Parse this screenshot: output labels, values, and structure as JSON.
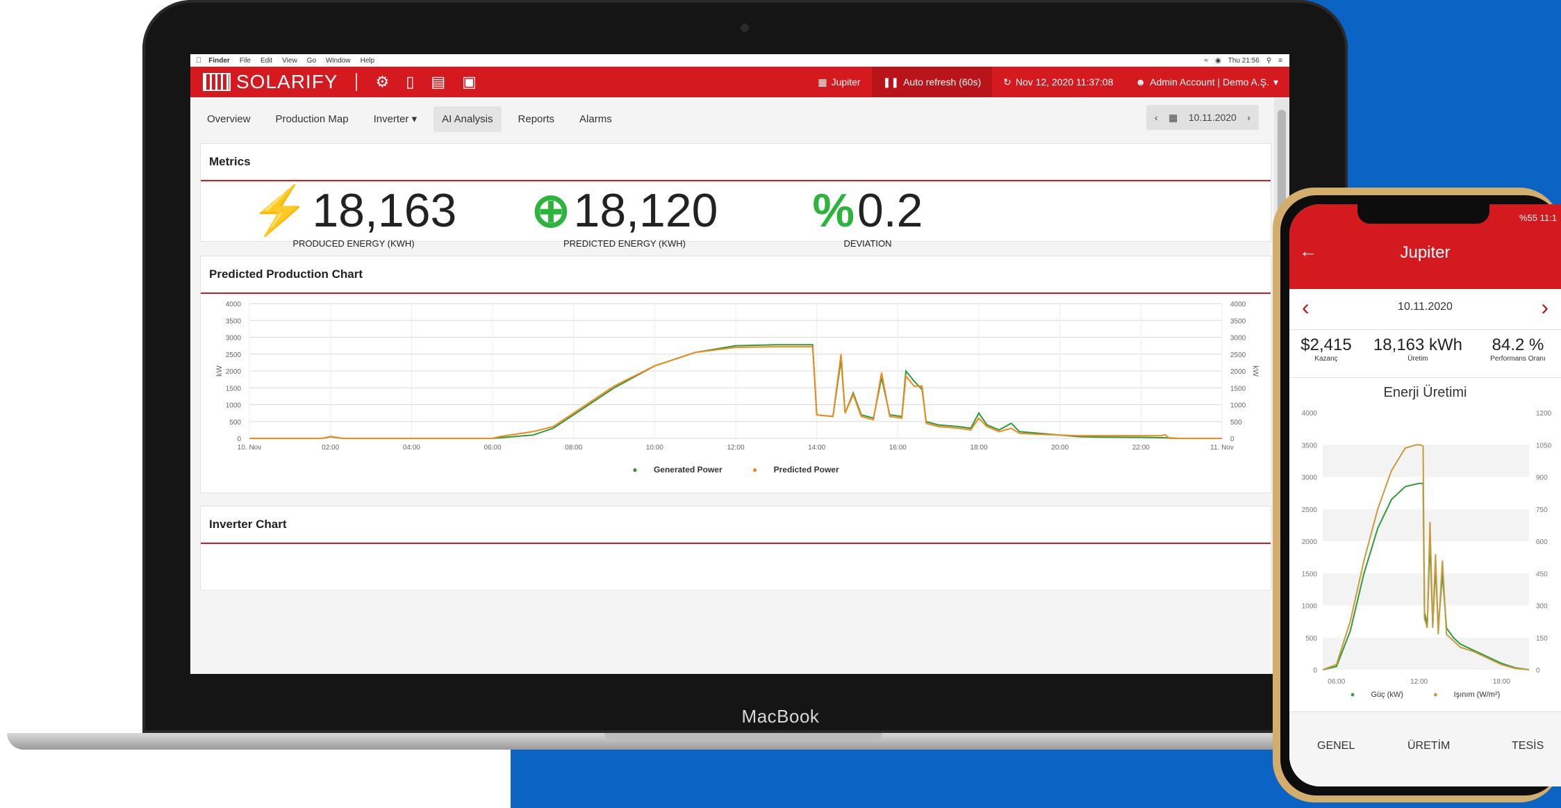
{
  "menubar": {
    "apple": "",
    "items": [
      "Finder",
      "File",
      "Edit",
      "View",
      "Go",
      "Window",
      "Help"
    ],
    "clock": "Thu 21:56"
  },
  "app": {
    "brand": "SOLARIFY",
    "header": {
      "plant": "Jupiter",
      "auto_refresh": "Auto refresh (60s)",
      "datetime": "Nov 12, 2020 11:37:08",
      "account": "Admin Account | Demo A.Ş."
    },
    "nav": {
      "tabs": [
        "Overview",
        "Production Map",
        "Inverter",
        "AI Analysis",
        "Reports",
        "Alarms"
      ],
      "date": "10.11.2020"
    },
    "metrics": {
      "title": "Metrics",
      "items": [
        {
          "value": "18,163",
          "label": "PRODUCED ENERGY (KWH)",
          "icon": "plug-icon"
        },
        {
          "value": "18,120",
          "label": "PREDICTED ENERGY (KWH)",
          "icon": "target-icon"
        },
        {
          "value": "0.2",
          "label": "DEVIATION",
          "icon": "percent-icon"
        }
      ]
    },
    "chart_section_title": "Predicted Production Chart",
    "next_section_title": "Inverter Chart"
  },
  "chart_data": [
    {
      "type": "line",
      "ylabel": "kW",
      "ylim": [
        0,
        4000
      ],
      "yticks": [
        0,
        500,
        1000,
        1500,
        2000,
        2500,
        3000,
        3500,
        4000
      ],
      "xticks": [
        "10. Nov",
        "02:00",
        "04:00",
        "06:00",
        "08:00",
        "10:00",
        "12:00",
        "14:00",
        "16:00",
        "18:00",
        "20:00",
        "22:00",
        "11. Nov"
      ],
      "xrange_hours": [
        0,
        24
      ],
      "series": [
        {
          "name": "Generated Power",
          "color": "#2e9a3a",
          "points": [
            [
              0,
              0
            ],
            [
              1.8,
              0
            ],
            [
              2,
              50
            ],
            [
              2.3,
              0
            ],
            [
              6,
              0
            ],
            [
              7,
              100
            ],
            [
              7.5,
              300
            ],
            [
              8,
              700
            ],
            [
              9,
              1500
            ],
            [
              10,
              2150
            ],
            [
              11,
              2550
            ],
            [
              12,
              2750
            ],
            [
              13,
              2780
            ],
            [
              13.9,
              2780
            ],
            [
              14,
              700
            ],
            [
              14.4,
              650
            ],
            [
              14.6,
              2350
            ],
            [
              14.7,
              750
            ],
            [
              14.9,
              1350
            ],
            [
              15.1,
              700
            ],
            [
              15.4,
              600
            ],
            [
              15.6,
              1800
            ],
            [
              15.8,
              700
            ],
            [
              16.1,
              650
            ],
            [
              16.2,
              2000
            ],
            [
              16.4,
              1700
            ],
            [
              16.6,
              1450
            ],
            [
              16.7,
              500
            ],
            [
              17,
              400
            ],
            [
              17.5,
              350
            ],
            [
              17.8,
              300
            ],
            [
              18,
              750
            ],
            [
              18.2,
              400
            ],
            [
              18.5,
              250
            ],
            [
              18.8,
              450
            ],
            [
              19,
              200
            ],
            [
              19.5,
              150
            ],
            [
              20,
              100
            ],
            [
              20.5,
              50
            ],
            [
              21,
              40
            ],
            [
              22,
              30
            ],
            [
              22.5,
              20
            ],
            [
              23,
              0
            ],
            [
              24,
              0
            ]
          ]
        },
        {
          "name": "Predicted Power",
          "color": "#f08a1c",
          "points": [
            [
              0,
              0
            ],
            [
              1.8,
              0
            ],
            [
              2,
              60
            ],
            [
              2.3,
              0
            ],
            [
              6,
              0
            ],
            [
              6.2,
              60
            ],
            [
              7,
              200
            ],
            [
              7.5,
              350
            ],
            [
              8,
              750
            ],
            [
              9,
              1550
            ],
            [
              10,
              2150
            ],
            [
              11,
              2550
            ],
            [
              12,
              2700
            ],
            [
              13,
              2720
            ],
            [
              13.9,
              2720
            ],
            [
              14,
              700
            ],
            [
              14.4,
              650
            ],
            [
              14.6,
              2500
            ],
            [
              14.7,
              750
            ],
            [
              14.9,
              1300
            ],
            [
              15.1,
              650
            ],
            [
              15.4,
              550
            ],
            [
              15.6,
              1950
            ],
            [
              15.8,
              650
            ],
            [
              16.1,
              600
            ],
            [
              16.2,
              1850
            ],
            [
              16.4,
              1550
            ],
            [
              16.6,
              1550
            ],
            [
              16.7,
              450
            ],
            [
              17,
              350
            ],
            [
              17.5,
              300
            ],
            [
              17.8,
              250
            ],
            [
              18,
              600
            ],
            [
              18.2,
              350
            ],
            [
              18.5,
              200
            ],
            [
              18.8,
              300
            ],
            [
              19,
              150
            ],
            [
              19.5,
              120
            ],
            [
              20,
              100
            ],
            [
              20.5,
              80
            ],
            [
              21,
              80
            ],
            [
              22,
              80
            ],
            [
              22.5,
              80
            ],
            [
              22.6,
              110
            ],
            [
              22.7,
              0
            ],
            [
              24,
              0
            ]
          ]
        }
      ]
    },
    {
      "type": "line",
      "title": "Enerji Üretimi",
      "ylim": [
        0,
        4000
      ],
      "yticks_left": [
        0,
        500,
        1000,
        1500,
        2000,
        2500,
        3000,
        3500,
        4000
      ],
      "yticks_right": [
        0,
        150,
        300,
        450,
        600,
        750,
        900,
        1050,
        1200
      ],
      "xticks": [
        "06:00",
        "12:00",
        "18:00"
      ],
      "xrange_hours": [
        5,
        20
      ],
      "series": [
        {
          "name": "Güç (kW)",
          "color": "#2e9a3a",
          "points": [
            [
              5,
              0
            ],
            [
              6,
              50
            ],
            [
              7,
              600
            ],
            [
              8,
              1500
            ],
            [
              9,
              2200
            ],
            [
              10,
              2650
            ],
            [
              11,
              2850
            ],
            [
              12,
              2900
            ],
            [
              12.3,
              2900
            ],
            [
              12.4,
              900
            ],
            [
              12.6,
              700
            ],
            [
              12.8,
              2000
            ],
            [
              13,
              700
            ],
            [
              13.2,
              1600
            ],
            [
              13.4,
              650
            ],
            [
              13.7,
              1500
            ],
            [
              14,
              650
            ],
            [
              14.5,
              500
            ],
            [
              15,
              400
            ],
            [
              16,
              300
            ],
            [
              17,
              200
            ],
            [
              18,
              100
            ],
            [
              19,
              30
            ],
            [
              20,
              0
            ]
          ]
        },
        {
          "name": "Işınım (W/m²)",
          "color": "#c99a3a",
          "points": [
            [
              5,
              0
            ],
            [
              6,
              80
            ],
            [
              7,
              750
            ],
            [
              8,
              1700
            ],
            [
              9,
              2500
            ],
            [
              10,
              3100
            ],
            [
              11,
              3450
            ],
            [
              11.8,
              3500
            ],
            [
              12.1,
              3500
            ],
            [
              12.3,
              3480
            ],
            [
              12.4,
              800
            ],
            [
              12.6,
              650
            ],
            [
              12.8,
              2300
            ],
            [
              13,
              650
            ],
            [
              13.2,
              1800
            ],
            [
              13.4,
              550
            ],
            [
              13.7,
              1700
            ],
            [
              14,
              550
            ],
            [
              14.5,
              450
            ],
            [
              15,
              350
            ],
            [
              16,
              280
            ],
            [
              17,
              180
            ],
            [
              18,
              80
            ],
            [
              19,
              20
            ],
            [
              20,
              0
            ]
          ]
        }
      ]
    }
  ],
  "phone": {
    "status": "%55 11:1",
    "title": "Jupiter",
    "date": "10.11.2020",
    "stats": [
      {
        "value": "$2,415",
        "label": "Kazanç"
      },
      {
        "value": "18,163 kWh",
        "label": "Üretim"
      },
      {
        "value": "84.2 %",
        "label": "Performans Oranı"
      }
    ],
    "tabs": [
      "GENEL",
      "ÜRETİM",
      "TESİS"
    ]
  },
  "device_label": "MacBook",
  "colors": {
    "brand_red": "#d51a1f",
    "generated": "#2e9a3a",
    "predicted": "#f08a1c",
    "background_blue": "#0b64c4"
  }
}
